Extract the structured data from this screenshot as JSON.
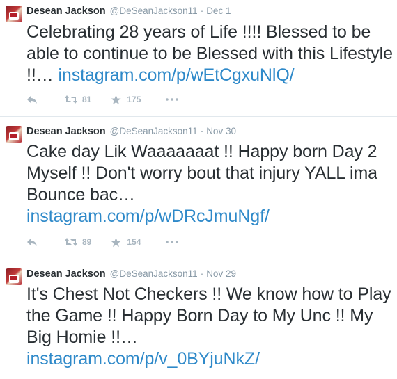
{
  "tweets": [
    {
      "name": "Desean Jackson",
      "handle": "@DeSeanJackson11",
      "separator": "·",
      "date": "Dec 1",
      "text": "Celebrating 28 years of Life !!!! Blessed to be able to continue to be Blessed with this Lifestyle !!… ",
      "link": "instagram.com/p/wEtCgxuNlQ/",
      "retweets": "81",
      "favorites": "175"
    },
    {
      "name": "Desean Jackson",
      "handle": "@DeSeanJackson11",
      "separator": "·",
      "date": "Nov 30",
      "text": "Cake day Lik Waaaaaaat !! Happy born Day 2 Myself !! Don't worry bout that injury YALL ima Bounce bac…",
      "link": "instagram.com/p/wDRcJmuNgf/",
      "retweets": "89",
      "favorites": "154"
    },
    {
      "name": "Desean Jackson",
      "handle": "@DeSeanJackson11",
      "separator": "·",
      "date": "Nov 29",
      "text": "It's Chest Not Checkers !! We know how to Play the Game !! Happy Born Day to My Unc !! My Big Homie !!…",
      "link": "instagram.com/p/v_0BYjuNkZ/"
    }
  ],
  "colors": {
    "link": "#2e89c9",
    "meta": "#8899a6",
    "icon": "#a9b6c0",
    "text": "#292f33"
  },
  "icons": [
    "reply-icon",
    "retweet-icon",
    "favorite-star-icon",
    "more-options-icon"
  ]
}
